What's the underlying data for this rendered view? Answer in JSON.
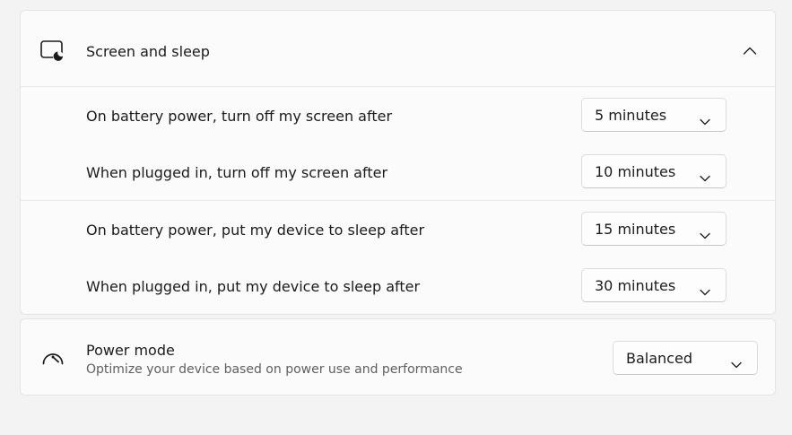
{
  "screen_sleep": {
    "title": "Screen and sleep",
    "header_icon": "screen-moon-icon",
    "expanded": true,
    "rows": [
      {
        "label": "On battery power, turn off my screen after",
        "value": "5 minutes"
      },
      {
        "label": "When plugged in, turn off my screen after",
        "value": "10 minutes"
      },
      {
        "label": "On battery power, put my device to sleep after",
        "value": "15 minutes"
      },
      {
        "label": "When plugged in, put my device to sleep after",
        "value": "30 minutes"
      }
    ]
  },
  "power_mode": {
    "icon": "speedometer-icon",
    "title": "Power mode",
    "subtitle": "Optimize your device based on power use and performance",
    "value": "Balanced"
  }
}
